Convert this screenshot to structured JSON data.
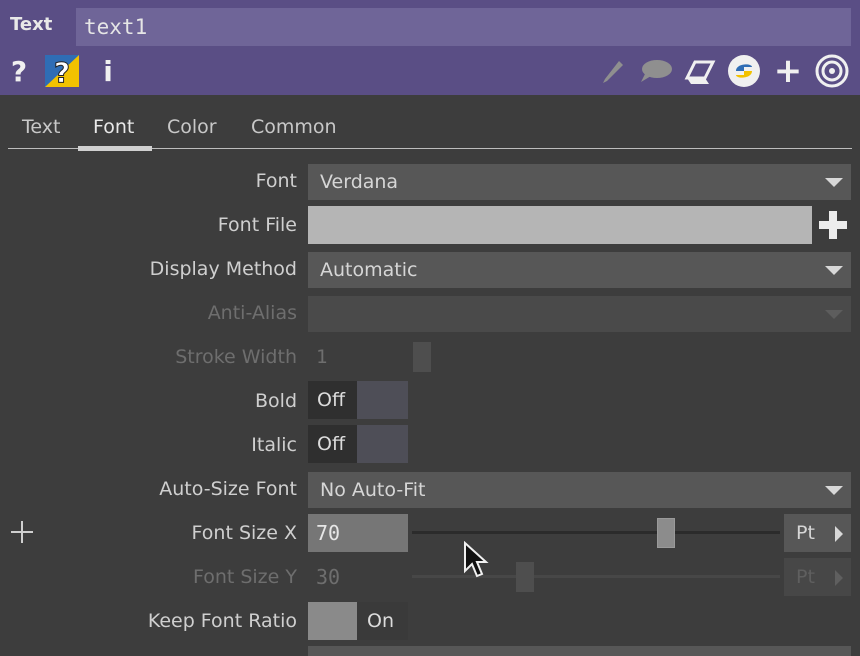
{
  "header": {
    "op_type": "Text",
    "op_name": "text1",
    "icons": [
      "help-icon",
      "python-help-icon",
      "info-icon",
      "edit-icon",
      "comment-icon",
      "clipboard-icon",
      "python-icon",
      "add-icon",
      "target-icon"
    ]
  },
  "tabs": [
    {
      "label": "Text"
    },
    {
      "label": "Font",
      "active": true
    },
    {
      "label": "Color"
    },
    {
      "label": "Common"
    }
  ],
  "params": {
    "font": {
      "label": "Font",
      "value": "Verdana"
    },
    "font_file": {
      "label": "Font File",
      "value": ""
    },
    "display_method": {
      "label": "Display Method",
      "value": "Automatic"
    },
    "anti_alias": {
      "label": "Anti-Alias",
      "value": ""
    },
    "stroke_width": {
      "label": "Stroke Width",
      "value": "1"
    },
    "bold": {
      "label": "Bold",
      "value": "Off"
    },
    "italic": {
      "label": "Italic",
      "value": "Off"
    },
    "auto_size_font": {
      "label": "Auto-Size Font",
      "value": "No Auto-Fit"
    },
    "font_size_x": {
      "label": "Font Size X",
      "value": "70",
      "unit": "Pt"
    },
    "font_size_y": {
      "label": "Font Size Y",
      "value": "30",
      "unit": "Pt"
    },
    "keep_font_ratio": {
      "label": "Keep Font Ratio",
      "value": "On"
    }
  },
  "colors": {
    "header_bg": "#5a4e85",
    "panel_bg": "#3d3d3d",
    "accent_yellow": "#f2c200"
  }
}
